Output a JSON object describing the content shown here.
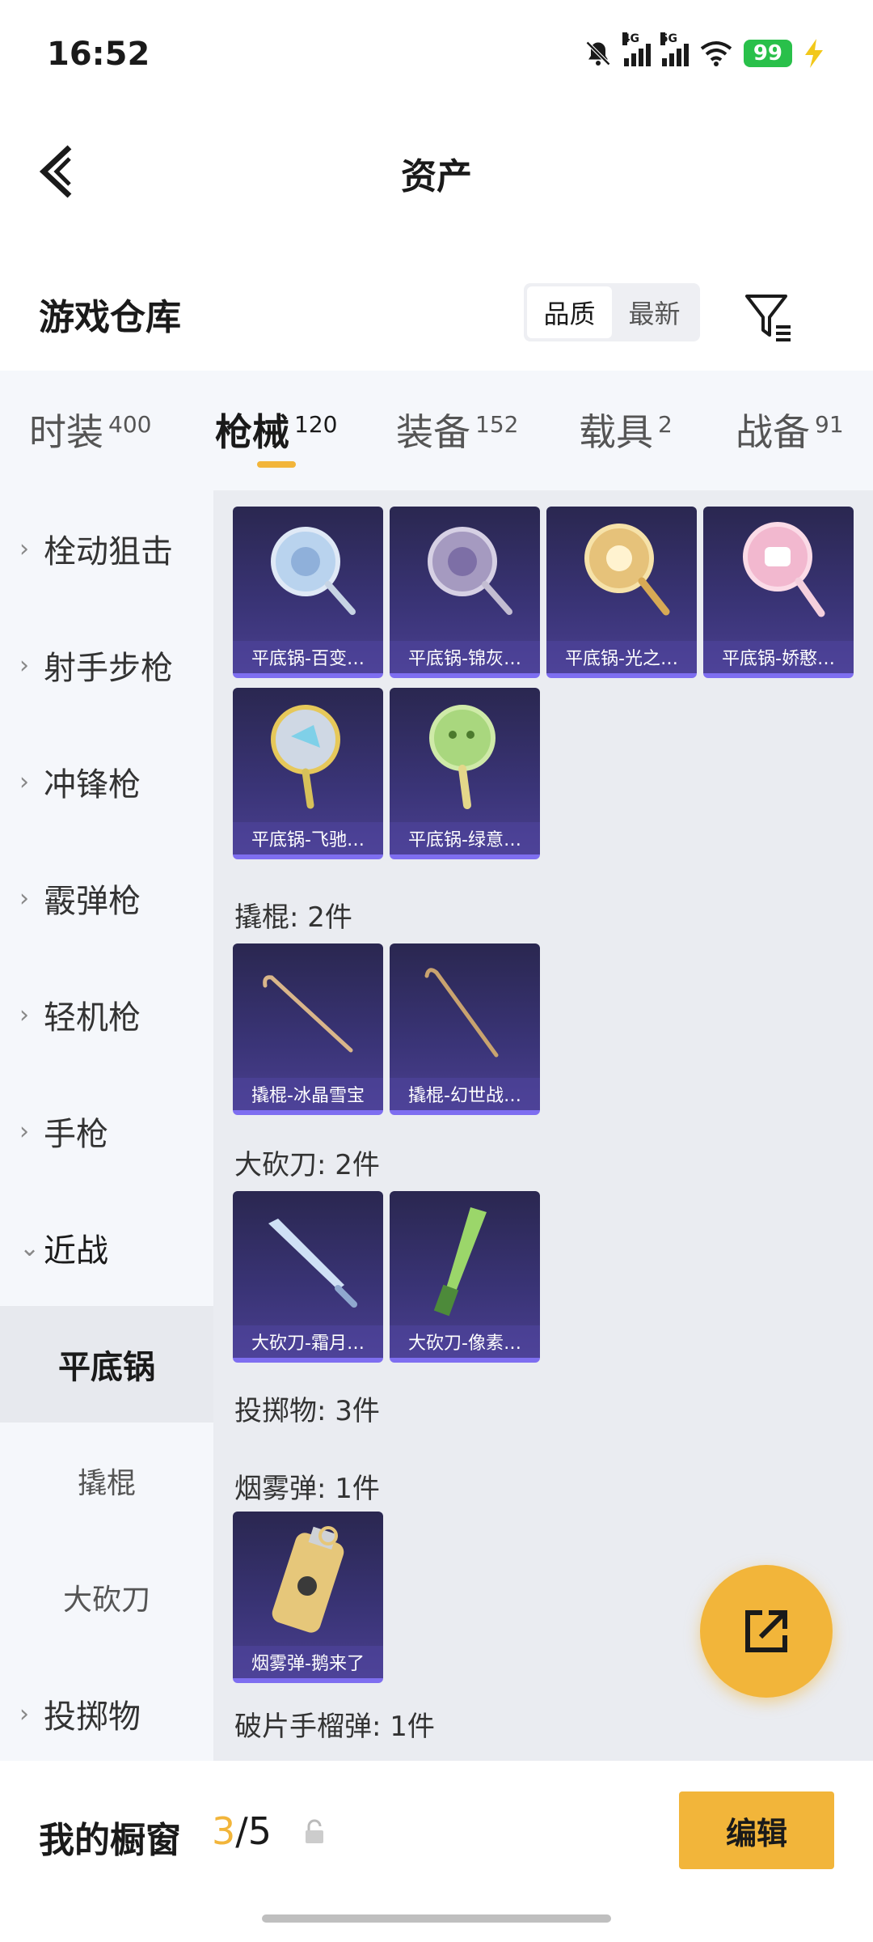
{
  "status": {
    "time": "16:52",
    "net1": "4G",
    "net2": "5G",
    "battery": "99"
  },
  "nav": {
    "title": "资产"
  },
  "warehouse": {
    "title": "游戏仓库",
    "sort_options": [
      "品质",
      "最新"
    ],
    "sort_active": "品质"
  },
  "tabs": [
    {
      "label": "时装",
      "count": "400"
    },
    {
      "label": "枪械",
      "count": "120",
      "active": true
    },
    {
      "label": "装备",
      "count": "152"
    },
    {
      "label": "载具",
      "count": "2"
    },
    {
      "label": "战备",
      "count": "91"
    }
  ],
  "sidebar": {
    "items": [
      {
        "label": "栓动狙击"
      },
      {
        "label": "射手步枪"
      },
      {
        "label": "冲锋枪"
      },
      {
        "label": "霰弹枪"
      },
      {
        "label": "轻机枪"
      },
      {
        "label": "手枪"
      },
      {
        "label": "近战",
        "open": true
      },
      {
        "label": "投掷物"
      }
    ],
    "sub_items": [
      {
        "label": "平底锅",
        "active": true
      },
      {
        "label": "撬棍"
      },
      {
        "label": "大砍刀"
      }
    ]
  },
  "content": {
    "pans": [
      "平底锅-百变…",
      "平底锅-锦灰…",
      "平底锅-光之…",
      "平底锅-娇憨…",
      "平底锅-飞驰…",
      "平底锅-绿意…"
    ],
    "crowbar_header": "撬棍: 2件",
    "crowbars": [
      "撬棍-冰晶雪宝",
      "撬棍-幻世战…"
    ],
    "machete_header": "大砍刀: 2件",
    "machetes": [
      "大砍刀-霜月…",
      "大砍刀-像素…"
    ],
    "throwable_header": "投掷物: 3件",
    "smoke_header": "烟雾弹: 1件",
    "smokes": [
      "烟雾弹-鹅来了"
    ],
    "frag_header": "破片手榴弹: 1件"
  },
  "bottom": {
    "label": "我的橱窗",
    "current": "3",
    "total": "/5",
    "edit": "编辑"
  },
  "colors": {
    "accent": "#f2b53a",
    "card_bg": "#3a3477",
    "battery": "#29c04a"
  }
}
